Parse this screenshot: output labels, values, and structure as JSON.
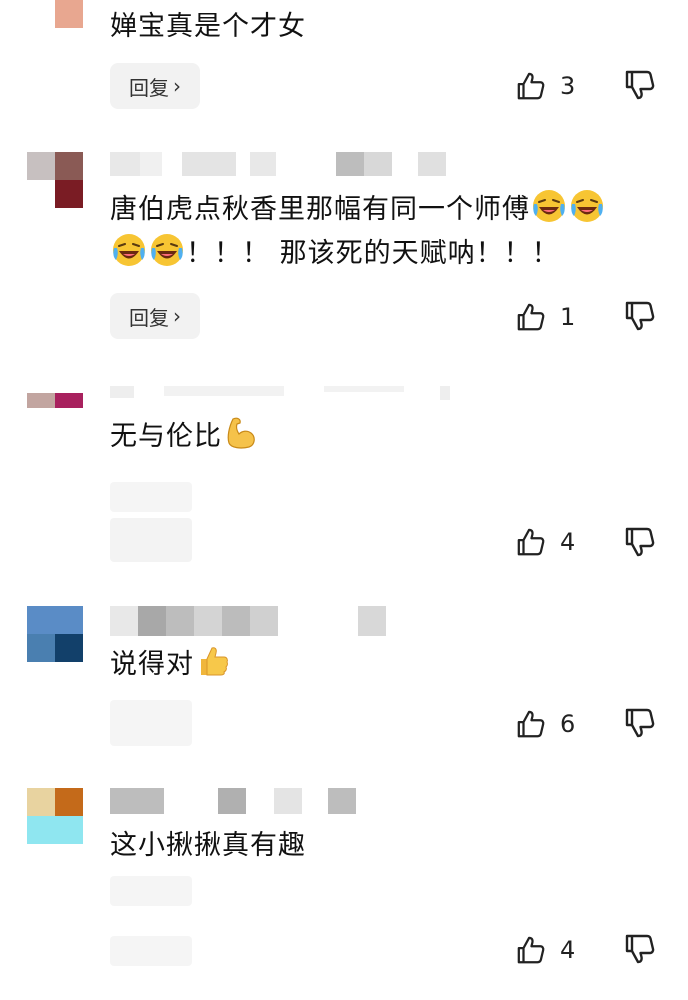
{
  "comments": [
    {
      "text": "婵宝真是个才女",
      "reply_label": "回复",
      "likes": "3",
      "avatar_colors": [
        "#e8a790",
        "#e8a790",
        "#e8a790",
        "#e8a790"
      ]
    },
    {
      "text_line1": "唐伯虎点秋香里那幅有同一个师傅",
      "text_line2": "！！！ 那该死的天赋呐！！！",
      "reply_label": "回复",
      "likes": "1",
      "avatar_colors": [
        "#c7c0c0",
        "#8a5a55",
        "#ffffff",
        "#7a1c24"
      ]
    },
    {
      "text": "无与伦比",
      "likes": "4",
      "avatar_colors": [
        "#c2a5a0",
        "#a8215e",
        "#ffffff",
        "#ffffff"
      ]
    },
    {
      "text": "说得对",
      "likes": "6",
      "avatar_colors": [
        "#5a8cc6",
        "#5a8cc6",
        "#4a7fb0",
        "#12406a"
      ]
    },
    {
      "text": "这小揪揪真有趣",
      "likes": "4",
      "avatar_colors": [
        "#e8d3a0",
        "#c46a1a",
        "#8fe6f0",
        "#8fe6f0"
      ]
    }
  ],
  "colors": {
    "reply_bg": "#f2f2f2",
    "blur_gray": "#bdbdbd"
  },
  "icons": {
    "like": "thumbs-up-outline-icon",
    "dislike": "thumbs-down-outline-icon",
    "emoji_laugh": "rolling-laughing-emoji",
    "emoji_muscle": "flexed-biceps-emoji",
    "emoji_thumb": "thumbs-up-emoji"
  }
}
